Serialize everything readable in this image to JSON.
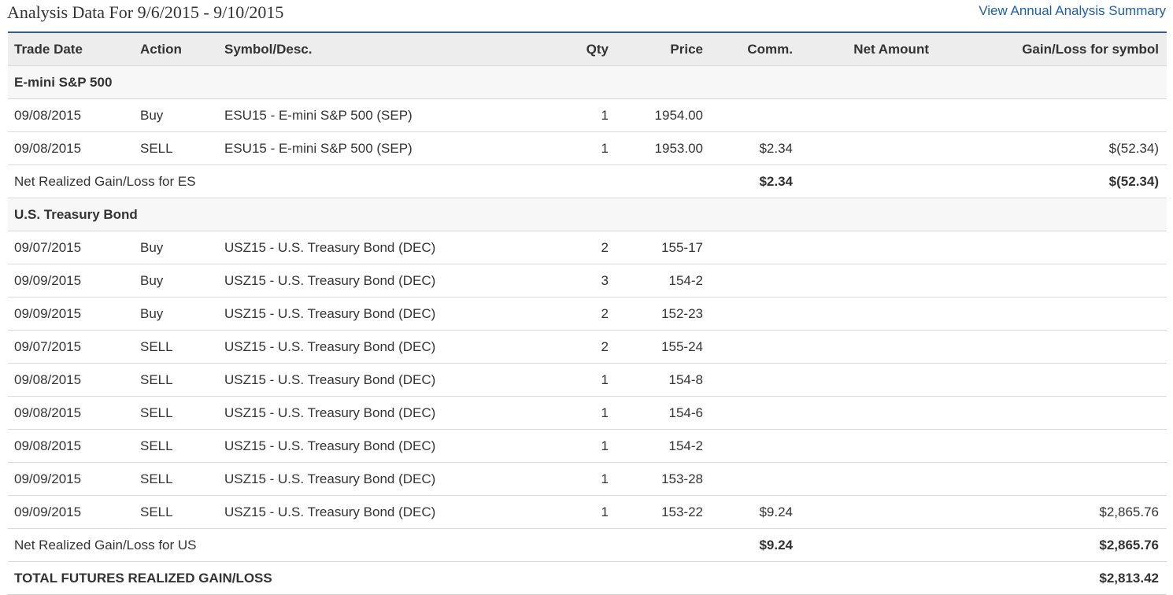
{
  "title": "Analysis Data For 9/6/2015 - 9/10/2015",
  "summary_link": "View Annual Analysis Summary",
  "columns": {
    "trade_date": "Trade Date",
    "action": "Action",
    "symbol": "Symbol/Desc.",
    "qty": "Qty",
    "price": "Price",
    "comm": "Comm.",
    "net_amount": "Net Amount",
    "gain_loss": "Gain/Loss for symbol"
  },
  "groups": [
    {
      "name": "E-mini S&P 500",
      "rows": [
        {
          "date": "09/08/2015",
          "action": "Buy",
          "symbol": "ESU15 - E-mini S&P 500 (SEP)",
          "qty": "1",
          "price": "1954.00",
          "comm": "",
          "net": "",
          "gain": ""
        },
        {
          "date": "09/08/2015",
          "action": "SELL",
          "symbol": "ESU15 - E-mini S&P 500 (SEP)",
          "qty": "1",
          "price": "1953.00",
          "comm": "$2.34",
          "net": "",
          "gain": "$(52.34)"
        }
      ],
      "subtotal": {
        "label": "Net Realized Gain/Loss for ES",
        "comm": "$2.34",
        "gain": "$(52.34)"
      }
    },
    {
      "name": "U.S. Treasury Bond",
      "rows": [
        {
          "date": "09/07/2015",
          "action": "Buy",
          "symbol": "USZ15 - U.S. Treasury Bond (DEC)",
          "qty": "2",
          "price": "155-17",
          "comm": "",
          "net": "",
          "gain": ""
        },
        {
          "date": "09/09/2015",
          "action": "Buy",
          "symbol": "USZ15 - U.S. Treasury Bond (DEC)",
          "qty": "3",
          "price": "154-2",
          "comm": "",
          "net": "",
          "gain": ""
        },
        {
          "date": "09/09/2015",
          "action": "Buy",
          "symbol": "USZ15 - U.S. Treasury Bond (DEC)",
          "qty": "2",
          "price": "152-23",
          "comm": "",
          "net": "",
          "gain": ""
        },
        {
          "date": "09/07/2015",
          "action": "SELL",
          "symbol": "USZ15 - U.S. Treasury Bond (DEC)",
          "qty": "2",
          "price": "155-24",
          "comm": "",
          "net": "",
          "gain": ""
        },
        {
          "date": "09/08/2015",
          "action": "SELL",
          "symbol": "USZ15 - U.S. Treasury Bond (DEC)",
          "qty": "1",
          "price": "154-8",
          "comm": "",
          "net": "",
          "gain": ""
        },
        {
          "date": "09/08/2015",
          "action": "SELL",
          "symbol": "USZ15 - U.S. Treasury Bond (DEC)",
          "qty": "1",
          "price": "154-6",
          "comm": "",
          "net": "",
          "gain": ""
        },
        {
          "date": "09/08/2015",
          "action": "SELL",
          "symbol": "USZ15 - U.S. Treasury Bond (DEC)",
          "qty": "1",
          "price": "154-2",
          "comm": "",
          "net": "",
          "gain": ""
        },
        {
          "date": "09/09/2015",
          "action": "SELL",
          "symbol": "USZ15 - U.S. Treasury Bond (DEC)",
          "qty": "1",
          "price": "153-28",
          "comm": "",
          "net": "",
          "gain": ""
        },
        {
          "date": "09/09/2015",
          "action": "SELL",
          "symbol": "USZ15 - U.S. Treasury Bond (DEC)",
          "qty": "1",
          "price": "153-22",
          "comm": "$9.24",
          "net": "",
          "gain": "$2,865.76"
        }
      ],
      "subtotal": {
        "label": "Net Realized Gain/Loss for US",
        "comm": "$9.24",
        "gain": "$2,865.76"
      }
    }
  ],
  "total": {
    "label": "TOTAL FUTURES REALIZED GAIN/LOSS",
    "gain": "$2,813.42"
  },
  "colors": {
    "link": "#1f5fa6",
    "header_bg": "#ededed",
    "border_top": "#3d5a86"
  }
}
